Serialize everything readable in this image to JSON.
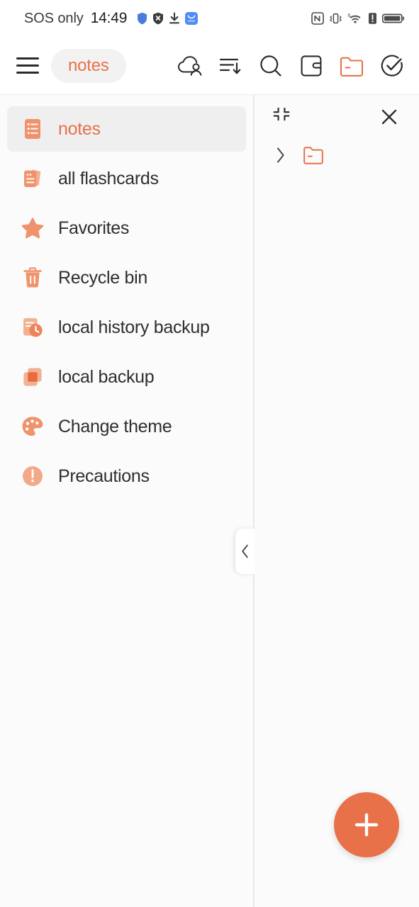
{
  "status_bar": {
    "carrier": "SOS only",
    "time": "14:49",
    "left_icons": [
      "shield-blue-icon",
      "shield-x-icon",
      "download-icon",
      "app-blue-icon"
    ],
    "right_icons": [
      "nfc-icon",
      "vibrate-icon",
      "wifi-6-icon",
      "alert-icon",
      "battery-icon"
    ]
  },
  "toolbar": {
    "menu_icon": "hamburger-menu-icon",
    "title": "notes",
    "actions": [
      {
        "name": "cloud-account-icon",
        "label": "cloud account"
      },
      {
        "name": "sort-icon",
        "label": "sort"
      },
      {
        "name": "search-icon",
        "label": "search"
      },
      {
        "name": "card-icon",
        "label": "card"
      },
      {
        "name": "folder-icon",
        "label": "folder"
      },
      {
        "name": "check-circle-icon",
        "label": "select"
      }
    ]
  },
  "sidebar": {
    "items": [
      {
        "label": "notes",
        "icon": "note-list-icon",
        "active": true
      },
      {
        "label": "all flashcards",
        "icon": "flashcards-icon",
        "active": false
      },
      {
        "label": "Favorites",
        "icon": "star-icon",
        "active": false
      },
      {
        "label": "Recycle bin",
        "icon": "trash-icon",
        "active": false
      },
      {
        "label": "local history backup",
        "icon": "history-backup-icon",
        "active": false
      },
      {
        "label": "local backup",
        "icon": "copy-backup-icon",
        "active": false
      },
      {
        "label": "Change theme",
        "icon": "palette-icon",
        "active": false
      },
      {
        "label": "Precautions",
        "icon": "warning-icon",
        "active": false
      }
    ],
    "collapse_handle_icon": "chevron-left-icon"
  },
  "right_panel": {
    "collapse_icon": "collapse-corners-icon",
    "close_icon": "close-icon",
    "tree_rows": [
      {
        "chevron": "chevron-right-icon",
        "folder": "folder-icon"
      }
    ],
    "fab_icon": "plus-icon"
  },
  "colors": {
    "accent": "#e8714a",
    "accent_light": "#f3a280",
    "page_bg": "#fbfbfb",
    "toolbar_bg": "#ffffff",
    "active_row_bg": "#efefef",
    "text": "#2e2e2e",
    "icon_dark": "#2b2b2b",
    "divider": "#e9e9e9"
  }
}
